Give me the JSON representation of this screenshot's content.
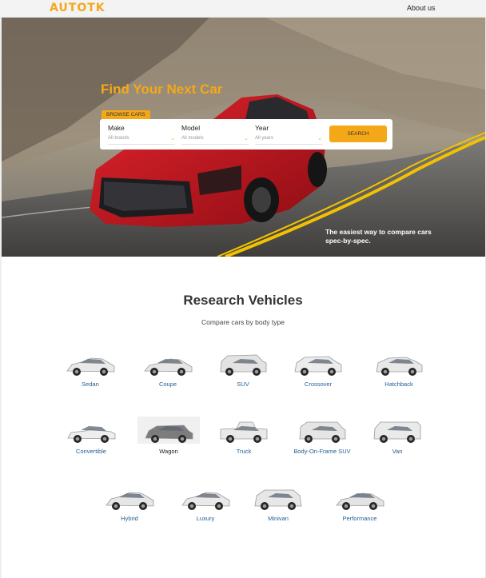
{
  "header": {
    "logo": "AUTOTK",
    "nav": {
      "about": "About us"
    }
  },
  "hero": {
    "title": "Find Your Next Car",
    "browse_tab": "BROWSE CARS",
    "fields": {
      "make": {
        "label": "Make",
        "placeholder": "All brands"
      },
      "model": {
        "label": "Model",
        "placeholder": "All models"
      },
      "year": {
        "label": "Year",
        "placeholder": "All years"
      }
    },
    "search_button": "SEARCH",
    "tagline": "The easiest way to compare cars spec-by-spec.",
    "colors": {
      "accent": "#f5a817",
      "car_red": "#c7161f",
      "road_line": "#f2c200"
    }
  },
  "research": {
    "title": "Research Vehicles",
    "subtitle": "Compare cars by body type",
    "body_types": [
      {
        "label": "Sedan",
        "icon": "sedan-car-icon"
      },
      {
        "label": "Coupe",
        "icon": "coupe-car-icon"
      },
      {
        "label": "SUV",
        "icon": "suv-car-icon"
      },
      {
        "label": "Crossover",
        "icon": "crossover-car-icon"
      },
      {
        "label": "Hatchback",
        "icon": "hatchback-car-icon"
      },
      {
        "label": "Convertible",
        "icon": "convertible-car-icon"
      },
      {
        "label": "Wagon",
        "icon": "wagon-car-icon"
      },
      {
        "label": "Truck",
        "icon": "truck-car-icon"
      },
      {
        "label": "Body-On-Frame SUV",
        "icon": "body-on-frame-suv-car-icon"
      },
      {
        "label": "Van",
        "icon": "van-car-icon"
      },
      {
        "label": "Hybrid",
        "icon": "hybrid-car-icon"
      },
      {
        "label": "Luxury",
        "icon": "luxury-car-icon"
      },
      {
        "label": "Minivan",
        "icon": "minivan-car-icon"
      },
      {
        "label": "Performance",
        "icon": "performance-car-icon"
      }
    ],
    "colors": {
      "link": "#1e5d96"
    }
  }
}
